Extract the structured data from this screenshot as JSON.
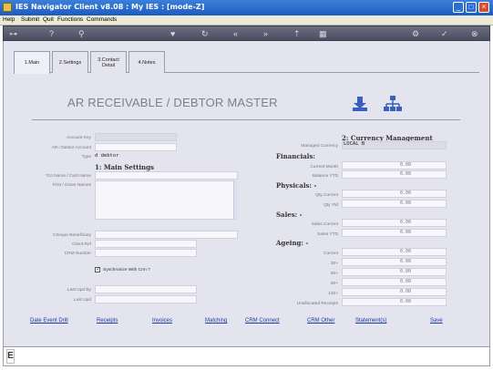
{
  "window": {
    "title": "IES Navigator Client v8.08 : My IES :      [mode-Z]"
  },
  "menu": {
    "items": [
      "Help",
      "Submit",
      "Quit",
      "Functions",
      "Commands"
    ]
  },
  "tabs": [
    {
      "label": "1.Main"
    },
    {
      "label": "2.Settings"
    },
    {
      "label": "3.Contact Detail"
    },
    {
      "label": "4.Notes"
    }
  ],
  "page_title": "AR RECEIVABLE / DEBTOR MASTER",
  "left": {
    "account_key": "Account Key",
    "ar_account": "AR / Debtor Account",
    "type_label": "Type",
    "type_value": "d debtor",
    "main_settings": "1: Main Settings",
    "co_name": "*Co Name / Cust Name",
    "first_names": "First / Given Names",
    "cheque_beneficiary": "Cheque Beneficiary",
    "client_ref": "Client Ref",
    "crm_number": "CRM Number",
    "sync_crm": "Synchronize With Crm ?",
    "last_upd_by": "Last Upd By",
    "last_upd": "Last Upd"
  },
  "right": {
    "currency_mgmt": "2: Currency Management",
    "managed_currency": "Managed Currency",
    "managed_currency_value": "LOCAL B",
    "financials": "Financials:",
    "current_month": "Current Month",
    "balance_ytd": "Balance YTD",
    "physicals": "Physicals: -",
    "qty_current": "Qty Current",
    "qty_ytd": "Qty Ytd",
    "sales": "Sales: -",
    "sales_current": "Sales Current",
    "sales_ytd": "Sales YTD",
    "ageing": "Ageing: -",
    "current": "Current",
    "d30": "30+",
    "d60": "60+",
    "d90": "90+",
    "d120": "120+",
    "unallocated": "Unallocated Receipts",
    "zero": "0.00"
  },
  "links": {
    "date_event_drill": "Date Event Drill",
    "receipts": "Receipts",
    "invoices": "Invoices",
    "matching": "Matching",
    "crm_connect": "CRM Connect",
    "crm_other": "CRM Other",
    "statements": "Statement(s)",
    "save": "Save"
  },
  "colors": {
    "titlebar": "#1c5cc0",
    "panel": "#e4e4ee",
    "link": "#1a3aa8"
  }
}
